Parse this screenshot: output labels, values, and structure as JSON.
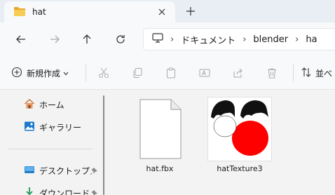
{
  "tab": {
    "title": "hat"
  },
  "address": {
    "crumbs": [
      "ドキュメント",
      "blender",
      "ha"
    ]
  },
  "command_bar": {
    "new_label": "新規作成",
    "sort_label": "並べ"
  },
  "sidebar": {
    "items": [
      {
        "label": "ホーム",
        "icon": "home-icon"
      },
      {
        "label": "ギャラリー",
        "icon": "gallery-icon"
      },
      {
        "label": "デスクトップ",
        "icon": "desktop-icon",
        "pinned": true
      },
      {
        "label": "ダウンロード",
        "icon": "download-icon",
        "pinned": true
      }
    ]
  },
  "files": [
    {
      "name": "hat.fbx",
      "type": "generic-file"
    },
    {
      "name": "hatTexture3",
      "type": "image"
    }
  ],
  "colors": {
    "accent": "#0067c0",
    "folder": "#f2c14e",
    "texture_red": "#ff0000",
    "texture_black": "#111111"
  }
}
